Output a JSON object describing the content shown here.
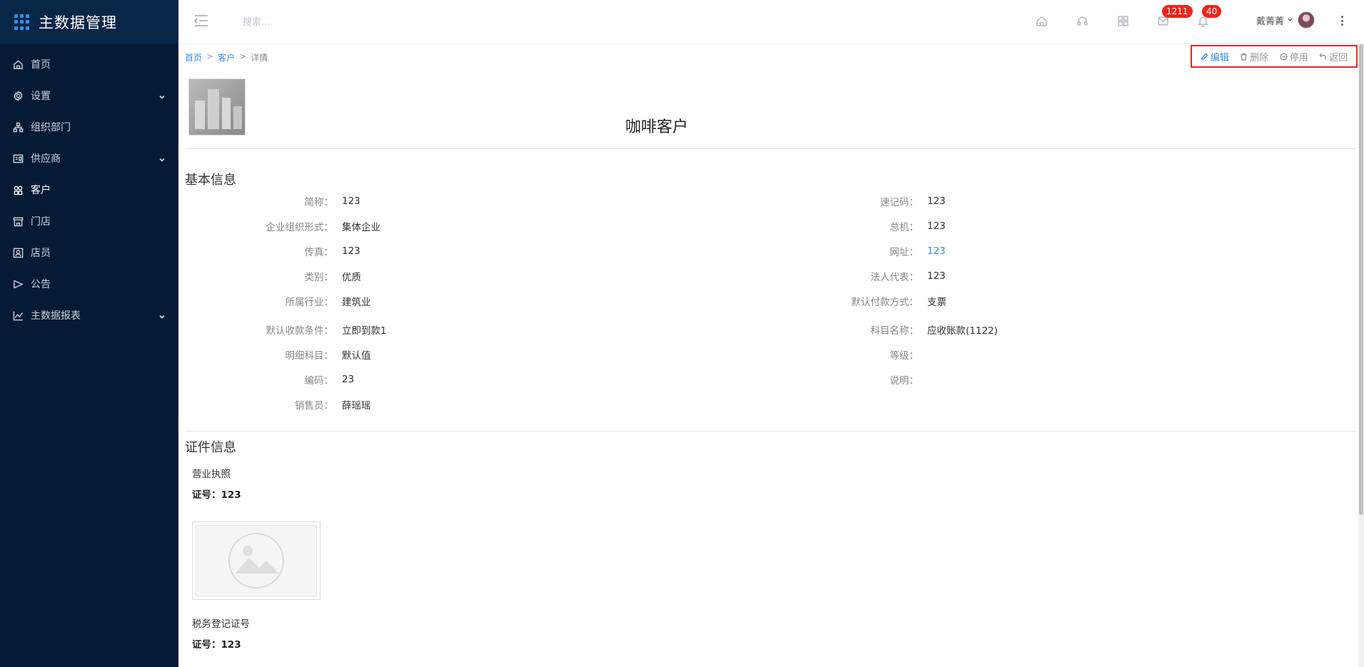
{
  "app": {
    "title": "主数据管理"
  },
  "sidebar": {
    "items": [
      {
        "label": "首页",
        "icon": "home-icon",
        "expandable": false,
        "active": false
      },
      {
        "label": "设置",
        "icon": "gear-icon",
        "expandable": true,
        "active": false
      },
      {
        "label": "组织部门",
        "icon": "org-icon",
        "expandable": false,
        "active": false
      },
      {
        "label": "供应商",
        "icon": "supplier-icon",
        "expandable": true,
        "active": false
      },
      {
        "label": "客户",
        "icon": "customer-icon",
        "expandable": false,
        "active": true
      },
      {
        "label": "门店",
        "icon": "store-icon",
        "expandable": false,
        "active": false
      },
      {
        "label": "店员",
        "icon": "clerk-icon",
        "expandable": false,
        "active": false
      },
      {
        "label": "公告",
        "icon": "notice-icon",
        "expandable": false,
        "active": false
      },
      {
        "label": "主数据报表",
        "icon": "report-icon",
        "expandable": true,
        "active": false
      }
    ]
  },
  "topbar": {
    "search_placeholder": "搜索...",
    "messages_badge": "1211",
    "notifications_badge": "40",
    "username": "戴菁菁"
  },
  "breadcrumb": {
    "home": "首页",
    "customer": "客户",
    "current": "详情",
    "sep": ">"
  },
  "actions": {
    "edit": "编辑",
    "delete": "删除",
    "disable": "停用",
    "back": "返回"
  },
  "detail": {
    "title": "咖啡客户",
    "basic_section": "基本信息",
    "left_fields": [
      {
        "label": "简称",
        "value": "123"
      },
      {
        "label": "企业组织形式",
        "value": "集体企业"
      },
      {
        "label": "传真",
        "value": "123"
      },
      {
        "label": "类别",
        "value": "优质"
      },
      {
        "label": "所属行业",
        "value": "建筑业"
      },
      {
        "label": "默认收款条件",
        "value": "立即到款1"
      },
      {
        "label": "明细科目",
        "value": "默认值"
      },
      {
        "label": "编码",
        "value": "23"
      },
      {
        "label": "销售员",
        "value": "薛瑶瑶"
      }
    ],
    "right_fields": [
      {
        "label": "速记码",
        "value": "123"
      },
      {
        "label": "总机",
        "value": "123"
      },
      {
        "label": "网址",
        "value": "123"
      },
      {
        "label": "法人代表",
        "value": "123"
      },
      {
        "label": "默认付款方式",
        "value": "支票"
      },
      {
        "label": "科目名称",
        "value": "应收账款(1122)"
      },
      {
        "label": "等级",
        "value": ""
      },
      {
        "label": "说明",
        "value": ""
      }
    ],
    "cert_section": "证件信息",
    "certs": [
      {
        "name": "营业执照",
        "number": "证号：123"
      },
      {
        "name": "税务登记证号",
        "number": "证号：123"
      }
    ]
  },
  "colors": {
    "sidebar_bg": "#051a33",
    "accent": "#3a8ee6",
    "badge": "#f0231c",
    "highlight": "#e22929"
  }
}
